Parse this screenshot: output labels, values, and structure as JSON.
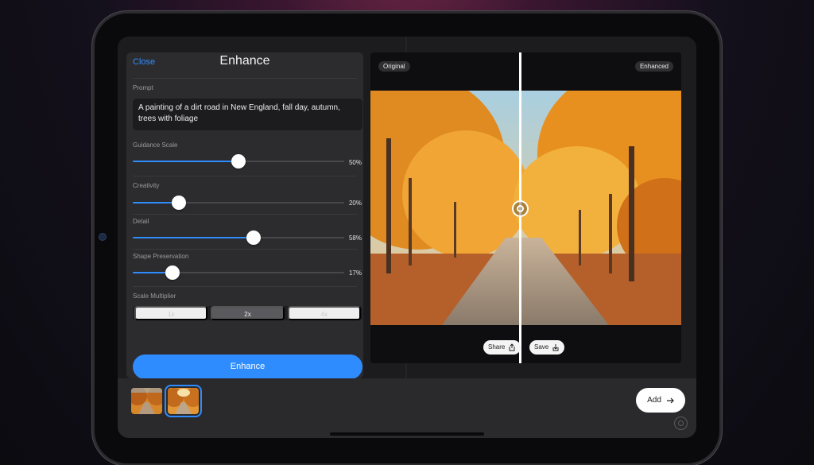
{
  "panel": {
    "close_label": "Close",
    "title": "Enhance",
    "prompt_label": "Prompt",
    "prompt_text": "A painting of a dirt road in New England, fall day, autumn, trees with foliage",
    "sliders": [
      {
        "label": "Guidance Scale",
        "value_text": "50%",
        "value": 0.5
      },
      {
        "label": "Creativity",
        "value_text": "20%",
        "value": 0.2
      },
      {
        "label": "Detail",
        "value_text": "58%",
        "value": 0.58
      },
      {
        "label": "Shape Preservation",
        "value_text": "17%",
        "value": 0.17
      }
    ],
    "scale_label": "Scale Multiplier",
    "scale_options": [
      "1x",
      "2x",
      "4x"
    ],
    "scale_selected": "2x",
    "enhance_label": "Enhance"
  },
  "compare": {
    "original_tag": "Original",
    "enhanced_tag": "Enhanced",
    "split_position": 0.48,
    "share_label": "Share",
    "save_label": "Save"
  },
  "bottom": {
    "add_label": "Add"
  },
  "colors": {
    "accent": "#2f8cff",
    "panel_bg": "#2c2c2e",
    "screen_bg": "#1c1c1e"
  },
  "icons": [
    "share-icon",
    "download-icon",
    "arrow-right-icon",
    "compare-handle-icon"
  ]
}
